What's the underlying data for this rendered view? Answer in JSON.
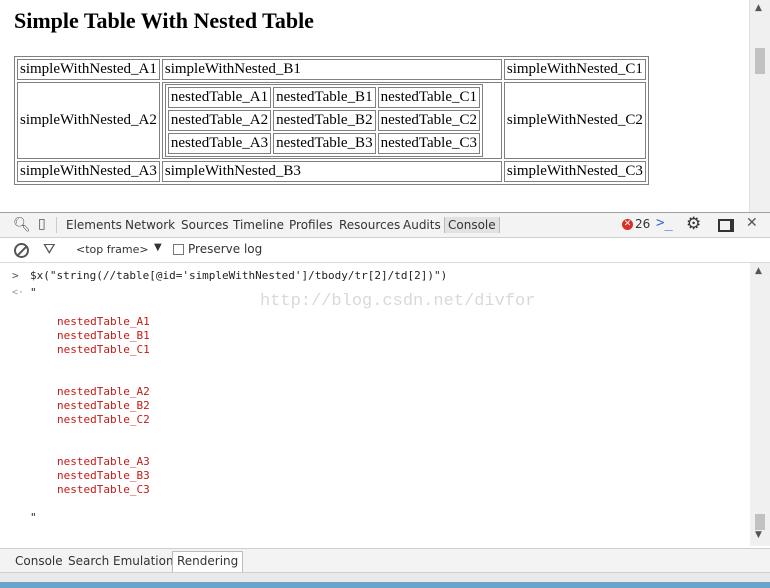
{
  "page": {
    "title": "Simple Table With Nested Table",
    "table": {
      "row1": [
        "simpleWithNested_A1",
        "simpleWithNested_B1",
        "simpleWithNested_C1"
      ],
      "row2_a": "simpleWithNested_A2",
      "row2_c": "simpleWithNested_C2",
      "nested": [
        [
          "nestedTable_A1",
          "nestedTable_B1",
          "nestedTable_C1"
        ],
        [
          "nestedTable_A2",
          "nestedTable_B2",
          "nestedTable_C2"
        ],
        [
          "nestedTable_A3",
          "nestedTable_B3",
          "nestedTable_C3"
        ]
      ],
      "row3": [
        "simpleWithNested_A3",
        "simpleWithNested_B3",
        "simpleWithNested_C3"
      ]
    }
  },
  "devtools": {
    "tabs": [
      "Elements",
      "Network",
      "Sources",
      "Timeline",
      "Profiles",
      "Resources",
      "Audits",
      "Console"
    ],
    "active_tab": "Console",
    "error_count": "26",
    "filter": {
      "frame": "<top frame>",
      "preserve_log": "Preserve log"
    },
    "console": {
      "input_glyph": ">",
      "output_glyph": "<·",
      "command": "$x(\"string(//table[@id='simpleWithNested']/tbody/tr[2]/td[2])\")",
      "quote_open": "\"",
      "quote_close": "\"",
      "lines": [
        "nestedTable_A1",
        "nestedTable_B1",
        "nestedTable_C1",
        "nestedTable_A2",
        "nestedTable_B2",
        "nestedTable_C2",
        "nestedTable_A3",
        "nestedTable_B3",
        "nestedTable_C3"
      ],
      "watermark": "http://blog.csdn.net/divfor",
      "prompt": ">"
    },
    "drawer_tabs": [
      "Console",
      "Search",
      "Emulation",
      "Rendering"
    ],
    "active_drawer_tab": "Rendering"
  },
  "colors": {
    "string_red": "#c41a16",
    "accent_blue": "#2a6dd6",
    "error_red": "#d93025"
  }
}
